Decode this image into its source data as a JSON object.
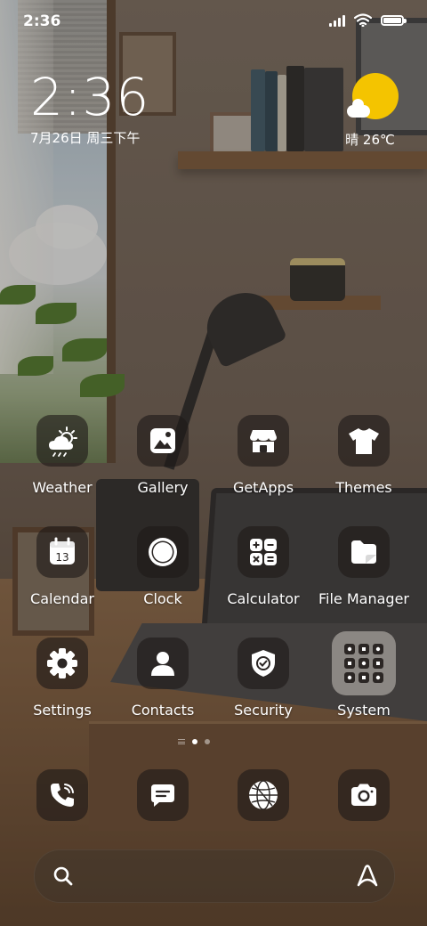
{
  "status_bar": {
    "time": "2:36",
    "icons": [
      "signal-icon",
      "wifi-icon",
      "battery-icon"
    ]
  },
  "clock_widget": {
    "time": "2:36",
    "date": "7月26日 周三下午"
  },
  "weather_widget": {
    "icon": "sun-cloud-icon",
    "text": "晴 26℃",
    "sun_color": "#f4c400"
  },
  "apps": [
    {
      "name": "Weather",
      "icon": "weather-icon"
    },
    {
      "name": "Gallery",
      "icon": "gallery-icon"
    },
    {
      "name": "GetApps",
      "icon": "getapps-icon"
    },
    {
      "name": "Themes",
      "icon": "themes-icon"
    },
    {
      "name": "Calendar",
      "icon": "calendar-icon",
      "day": "13"
    },
    {
      "name": "Clock",
      "icon": "clock-icon"
    },
    {
      "name": "Calculator",
      "icon": "calculator-icon"
    },
    {
      "name": "File Manager",
      "icon": "file-manager-icon"
    },
    {
      "name": "Settings",
      "icon": "settings-icon"
    },
    {
      "name": "Contacts",
      "icon": "contacts-icon"
    },
    {
      "name": "Security",
      "icon": "security-icon"
    },
    {
      "name": "System",
      "icon": "system-folder-icon"
    }
  ],
  "page_indicator": {
    "pages": 2,
    "active": 1
  },
  "dock": [
    {
      "name": "Phone",
      "icon": "phone-icon"
    },
    {
      "name": "Messages",
      "icon": "messages-icon"
    },
    {
      "name": "Browser",
      "icon": "browser-icon"
    },
    {
      "name": "Camera",
      "icon": "camera-icon"
    }
  ],
  "search_bar": {
    "left_icon": "search-icon",
    "right_icon": "assistant-icon"
  }
}
